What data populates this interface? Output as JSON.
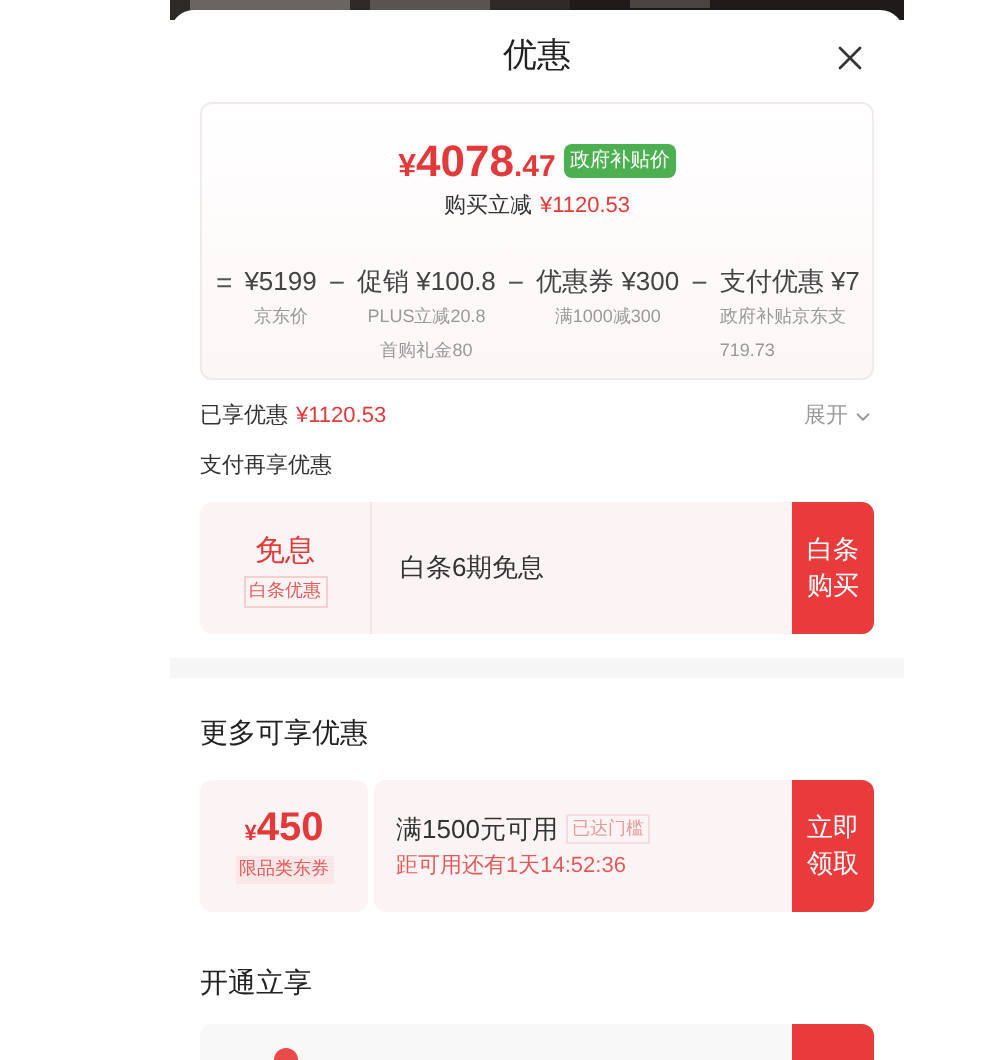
{
  "sheet": {
    "title": "优惠"
  },
  "summary": {
    "price_symbol": "¥",
    "price_int": "4078",
    "price_dec": ".47",
    "badge": "政府补贴价",
    "saving_label": "购买立减",
    "saving_value": "¥1120.53",
    "breakdown": [
      {
        "operator": "=",
        "amount": "¥5199",
        "notes": [
          "京东价"
        ]
      },
      {
        "operator": "−",
        "amount": "促销 ¥100.8",
        "notes": [
          "PLUS立减20.8",
          "首购礼金80"
        ]
      },
      {
        "operator": "−",
        "amount": "优惠券 ¥300",
        "notes": [
          "满1000减300"
        ]
      },
      {
        "operator": "−",
        "amount": "支付优惠 ¥7",
        "notes": [
          "政府补贴京东支",
          "719.73"
        ]
      }
    ]
  },
  "enjoyed": {
    "label": "已享优惠",
    "value": "¥1120.53",
    "toggle": "展开"
  },
  "pay_section": {
    "title": "支付再享优惠",
    "offers": [
      {
        "head": "免息",
        "tag": "白条优惠",
        "text": "白条6期免息",
        "action": "白条购买"
      }
    ]
  },
  "more_section": {
    "title": "更多可享优惠",
    "coupons": [
      {
        "symbol": "¥",
        "amount": "450",
        "tag": "限品类东券",
        "condition": "满1500元可用",
        "status": "已达门槛",
        "countdown": "距可用还有1天14:52:36",
        "action": "立即领取"
      }
    ]
  },
  "open_section": {
    "title": "开通立享"
  }
}
